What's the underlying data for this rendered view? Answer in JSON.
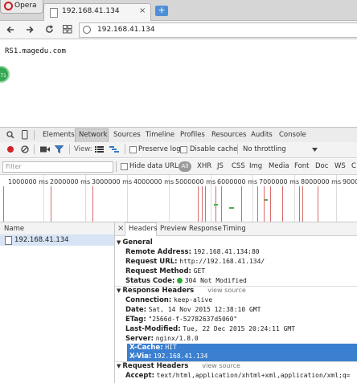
{
  "browser": {
    "menu_label": "Opera",
    "tab_title": "192.168.41.134",
    "tab_close": "×",
    "new_tab": "+",
    "url": "192.168.41.134"
  },
  "page": {
    "host_text": "RS1.magedu.com",
    "badge_text": "71"
  },
  "devtools": {
    "tabs": [
      "Elements",
      "Network",
      "Sources",
      "Timeline",
      "Profiles",
      "Resources",
      "Audits",
      "Console"
    ],
    "active_tab": "Network",
    "toolbar": {
      "view_label": "View:",
      "preserve_log": "Preserve log",
      "disable_cache": "Disable cache",
      "throttling": "No throttling"
    },
    "filter": {
      "placeholder": "Filter",
      "hide_data_urls": "Hide data URLs",
      "types": [
        "All",
        "XHR",
        "JS",
        "CSS",
        "Img",
        "Media",
        "Font",
        "Doc",
        "WS",
        "C"
      ]
    },
    "timeline_ticks": [
      "1000000 ms",
      "2000000 ms",
      "3000000 ms",
      "4000000 ms",
      "5000000 ms",
      "6000000 ms",
      "7000000 ms",
      "8000000 ms",
      "9000"
    ],
    "name_header": "Name",
    "requests": [
      "192.168.41.134"
    ],
    "detail_close": "×",
    "detail_tabs": [
      "Headers",
      "Preview",
      "Response",
      "Timing"
    ],
    "general": {
      "title": "General",
      "remote_address_label": "Remote Address:",
      "remote_address": "192.168.41.134:80",
      "request_url_label": "Request URL:",
      "request_url": "http://192.168.41.134/",
      "request_method_label": "Request Method:",
      "request_method": "GET",
      "status_code_label": "Status Code:",
      "status_code": "304 Not Modified",
      "status_color": "#2eaa3a"
    },
    "response_headers": {
      "title": "Response Headers",
      "view_source": "view source",
      "items": [
        {
          "name": "Connection:",
          "value": "keep-alive"
        },
        {
          "name": "Date:",
          "value": "Sat, 14 Nov 2015 12:38:10 GMT"
        },
        {
          "name": "ETag:",
          "value": "\"2566d-f-52782637d5060\""
        },
        {
          "name": "Last-Modified:",
          "value": "Tue, 22 Dec 2015 20:24:11 GMT"
        },
        {
          "name": "Server:",
          "value": "nginx/1.8.0"
        },
        {
          "name": "X-Cache:",
          "value": "HIT"
        },
        {
          "name": "X-Via:",
          "value": "192.168.41.134"
        }
      ]
    },
    "request_headers": {
      "title": "Request Headers",
      "view_source": "view source",
      "accept_label": "Accept:",
      "accept": "text/html,application/xhtml+xml,application/xml;q="
    }
  },
  "colors": {
    "selection": "#3a7fd0",
    "record_dot": "#d32222",
    "timeline_marker": "#d56b6b"
  }
}
